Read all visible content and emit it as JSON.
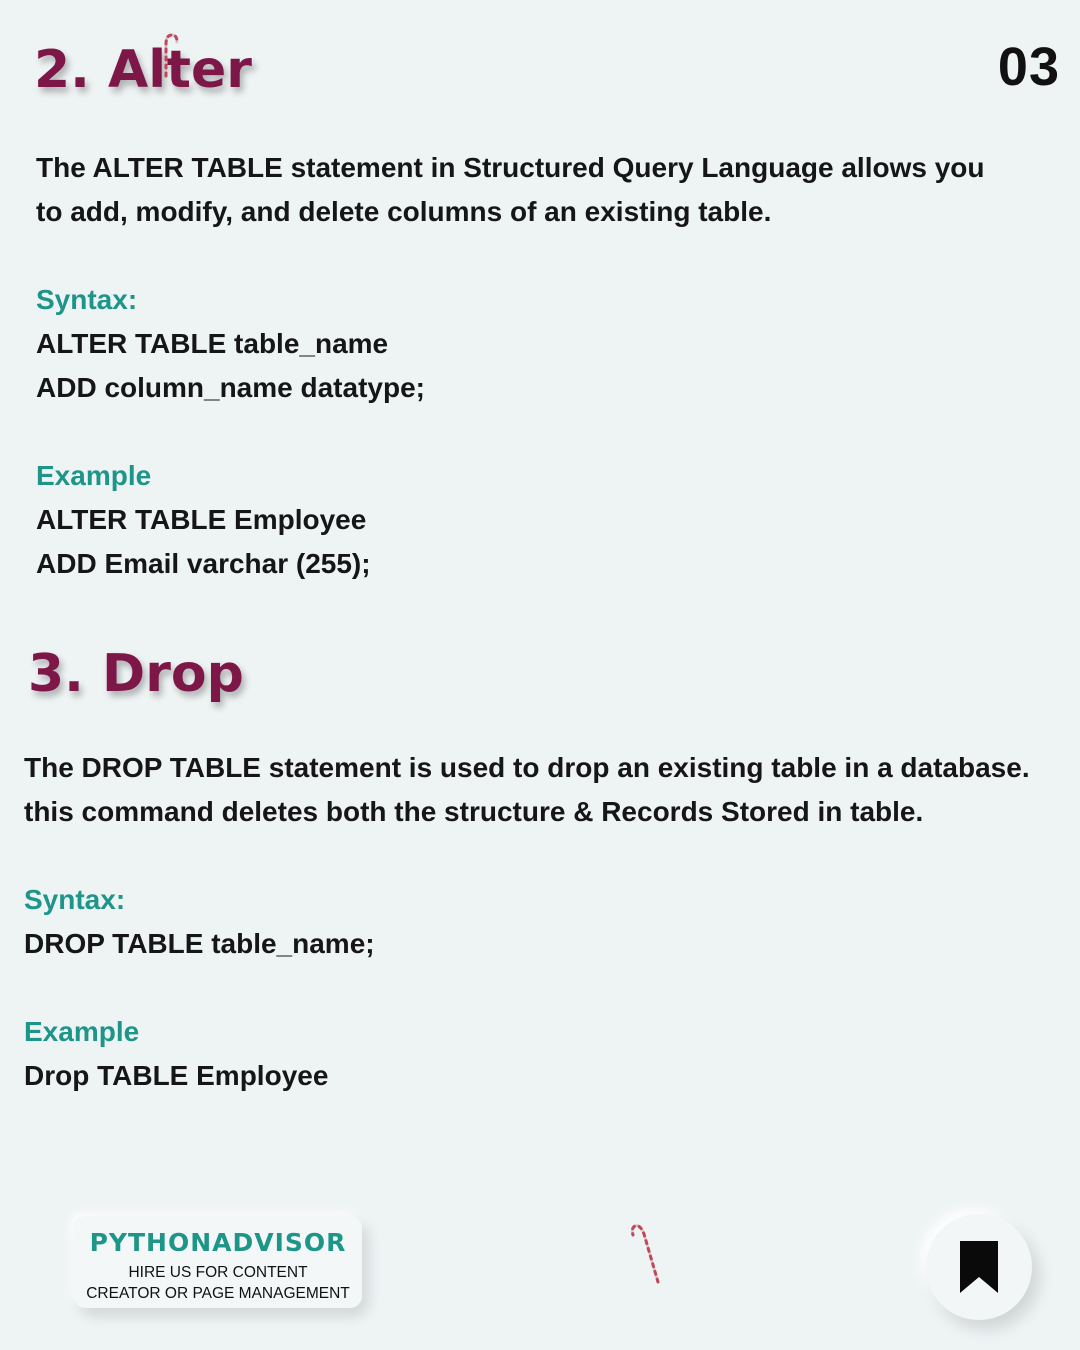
{
  "page_number": "03",
  "colors": {
    "heading": "#7d1747",
    "label": "#1e9589",
    "text": "#161616",
    "background": "#eef3f4"
  },
  "sections": [
    {
      "heading": "2. Alter",
      "description": "The ALTER TABLE statement in Structured Query Language allows you to add, modify, and delete columns of an existing table.",
      "syntax_label": "Syntax:",
      "syntax_lines": [
        "ALTER TABLE table_name",
        "ADD column_name datatype;"
      ],
      "example_label": "Example",
      "example_lines": [
        "ALTER TABLE Employee",
        "ADD Email varchar (255);"
      ]
    },
    {
      "heading": "3. Drop",
      "description": "The DROP TABLE statement is used to drop an existing table in a database. this command deletes both the structure & Records Stored in table.",
      "syntax_label": "Syntax:",
      "syntax_lines": [
        "DROP TABLE table_name;"
      ],
      "example_label": "Example",
      "example_lines": [
        "Drop TABLE Employee"
      ]
    }
  ],
  "footer": {
    "brand_name": "PYTHONADVISOR",
    "tagline_line1": "HIRE US FOR CONTENT",
    "tagline_line2": "CREATOR OR PAGE MANAGEMENT",
    "bookmark_icon": "bookmark-icon"
  }
}
